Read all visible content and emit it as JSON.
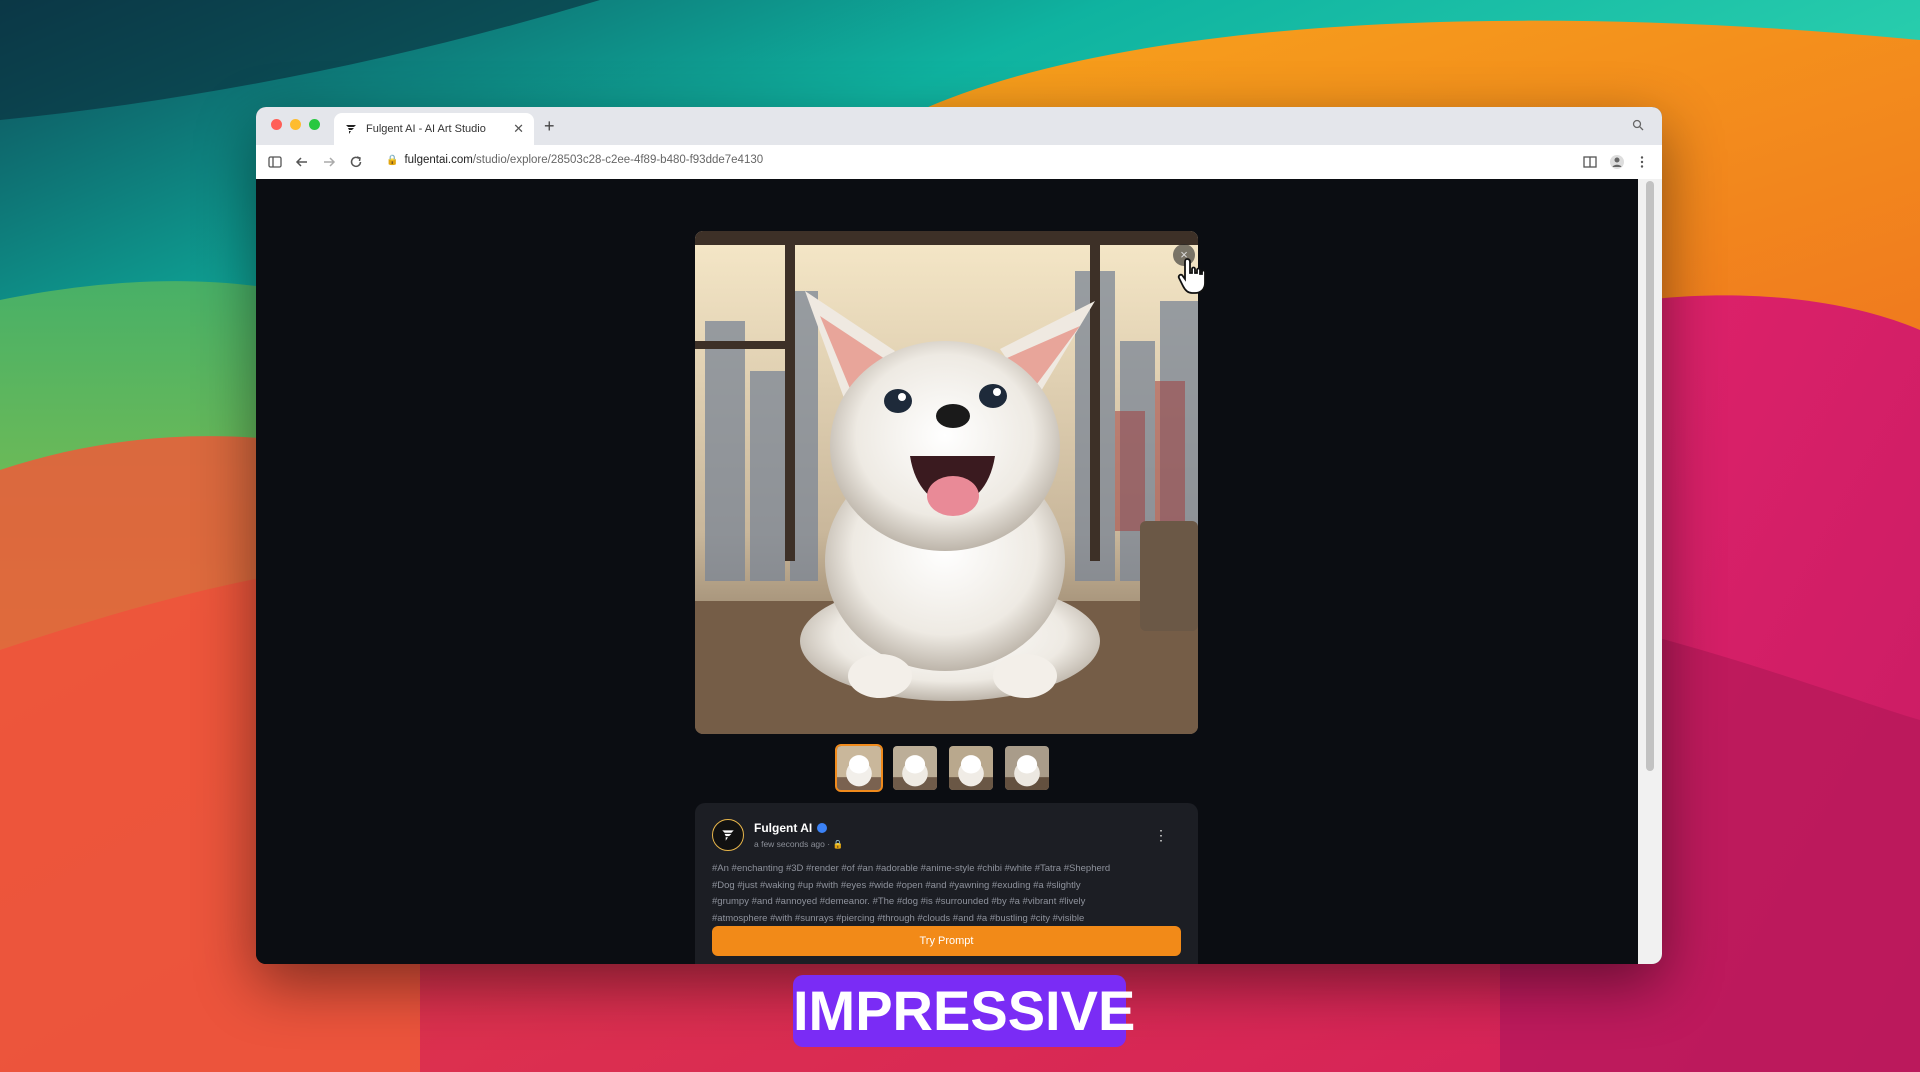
{
  "colors": {
    "accent": "#f28a18",
    "caption_bg": "#7a2cf5",
    "page_bg": "#0b0d12",
    "card_bg": "#1c1e24",
    "verified": "#3b82f6"
  },
  "browser": {
    "tab_title": "Fulgent AI - AI Art Studio",
    "url_domain": "fulgentai.com",
    "url_path": "/studio/explore/28503c28-c2ee-4f89-b480-f93dde7e4130",
    "icons": {
      "sidebar": "sidebar-icon",
      "back": "arrow-left-icon",
      "forward": "arrow-right-icon",
      "reload": "reload-icon",
      "lock": "lock-icon",
      "reader": "reader-icon",
      "profile": "profile-icon",
      "menu": "kebab-menu-icon",
      "search": "search-icon"
    }
  },
  "viewer": {
    "close_glyph": "×",
    "image_subject": "fluffy white puppy in city window",
    "thumbnails_count": 4
  },
  "card": {
    "author": "Fulgent AI",
    "time": "a few seconds ago",
    "prompt_lines": [
      "#An #enchanting #3D #render #of #an #adorable #anime-style #chibi #white #Tatra #Shepherd",
      "#Dog #just #waking #up #with #eyes #wide #open #and #yawning #exuding #a #slightly",
      "#grumpy #and #annoyed #demeanor. #The #dog #is #surrounded #by #a #vibrant #lively",
      "#atmosphere #with #sunrays #piercing #through #clouds #and #a #bustling #city #visible"
    ],
    "button": "Try Prompt"
  },
  "caption": "IMPRESSIVE"
}
